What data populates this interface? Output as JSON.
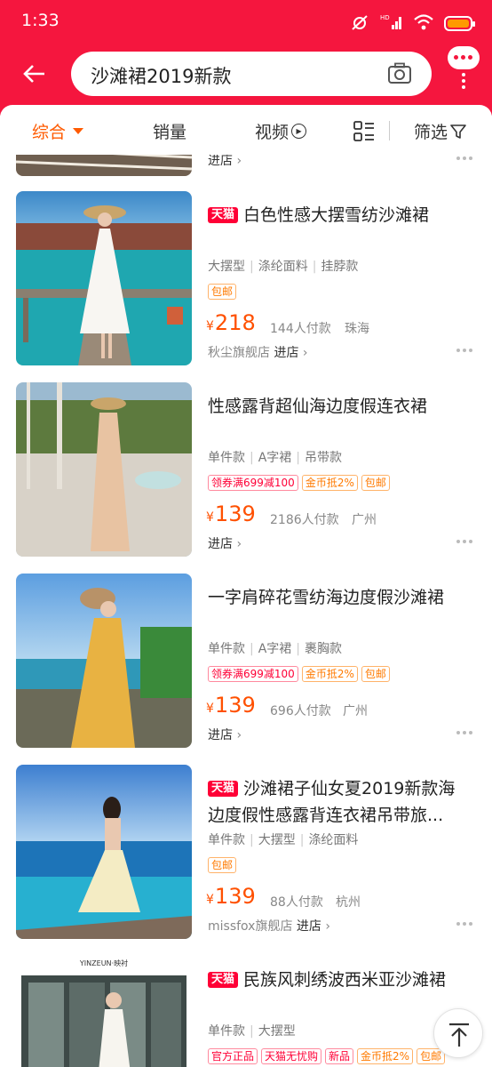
{
  "status_bar": {
    "time": "1:33",
    "hd_label": "HD"
  },
  "search": {
    "query": "沙滩裙2019新款"
  },
  "sort_bar": {
    "items": [
      "综合",
      "销量",
      "视频",
      "筛选"
    ]
  },
  "partial_row": {
    "enter_store": "进店"
  },
  "products": [
    {
      "tmall": "天猫",
      "title": "白色性感大摆雪纺沙滩裙",
      "attrs": [
        "大摆型",
        "涤纶面料",
        "挂脖款"
      ],
      "tags": [
        {
          "text": "包邮",
          "style": "orange"
        }
      ],
      "currency": "¥",
      "price": "218",
      "sales": "144人付款",
      "location": "珠海",
      "shop": "秋尘旗舰店",
      "enter_store": "进店"
    },
    {
      "tmall": "",
      "title": "性感露背超仙海边度假连衣裙",
      "attrs": [
        "单件款",
        "A字裙",
        "吊带款"
      ],
      "tags": [
        {
          "text": "领券满699减100",
          "style": "red"
        },
        {
          "text": "金币抵2%",
          "style": "orange"
        },
        {
          "text": "包邮",
          "style": "orange"
        }
      ],
      "currency": "¥",
      "price": "139",
      "sales": "2186人付款",
      "location": "广州",
      "shop": "",
      "enter_store": "进店"
    },
    {
      "tmall": "",
      "title": "一字肩碎花雪纺海边度假沙滩裙",
      "attrs": [
        "单件款",
        "A字裙",
        "裹胸款"
      ],
      "tags": [
        {
          "text": "领券满699减100",
          "style": "red"
        },
        {
          "text": "金币抵2%",
          "style": "orange"
        },
        {
          "text": "包邮",
          "style": "orange"
        }
      ],
      "currency": "¥",
      "price": "139",
      "sales": "696人付款",
      "location": "广州",
      "shop": "",
      "enter_store": "进店"
    },
    {
      "tmall": "天猫",
      "title": "沙滩裙子仙女夏2019新款海边度假性感露背连衣裙吊带旅...",
      "attrs": [
        "单件款",
        "大摆型",
        "涤纶面料"
      ],
      "tags": [
        {
          "text": "包邮",
          "style": "orange"
        }
      ],
      "currency": "¥",
      "price": "139",
      "sales": "88人付款",
      "location": "杭州",
      "shop": "missfox旗舰店",
      "enter_store": "进店"
    },
    {
      "tmall": "天猫",
      "title": "民族风刺绣波西米亚沙滩裙",
      "attrs": [
        "单件款",
        "大摆型"
      ],
      "tags": [
        {
          "text": "官方正品",
          "style": "red"
        },
        {
          "text": "天猫无忧购",
          "style": "red"
        },
        {
          "text": "新品",
          "style": "red"
        },
        {
          "text": "金币抵2%",
          "style": "orange"
        },
        {
          "text": "包邮",
          "style": "orange"
        }
      ],
      "image_caption": "YINZEUN·映衬"
    }
  ],
  "colors": {
    "header": "#f5163e",
    "price": "#ff5000",
    "active_sort": "#ff5a00",
    "tmall_badge": "#ff0036"
  }
}
